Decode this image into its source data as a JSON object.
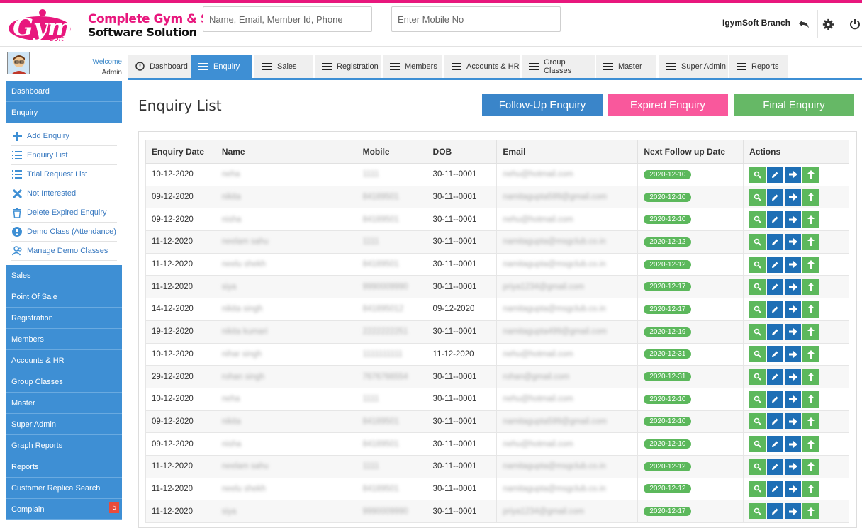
{
  "header": {
    "brand_line1": "Complete Gym & Spa",
    "brand_line2": "Software Solution",
    "search_placeholder": "Name, Email, Member Id, Phone",
    "mobile_placeholder": "Enter Mobile No",
    "branch": "IgymSoft Branch"
  },
  "user": {
    "welcome": "Welcome",
    "name": "Admin"
  },
  "sidebar": {
    "top_items": [
      "Dashboard",
      "Enquiry"
    ],
    "sub_items": [
      {
        "label": "Add Enquiry",
        "icon": "plus-icon"
      },
      {
        "label": "Enquiry List",
        "icon": "list-icon"
      },
      {
        "label": "Trial Request List",
        "icon": "list-icon"
      },
      {
        "label": "Not Interested",
        "icon": "close-icon"
      },
      {
        "label": "Delete Expired Enquiry",
        "icon": "trash-icon"
      },
      {
        "label": "Demo Class (Attendance)",
        "icon": "alert-icon"
      },
      {
        "label": "Manage Demo Classes",
        "icon": "users-icon"
      }
    ],
    "bottom_items": [
      "Sales",
      "Point Of Sale",
      "Registration",
      "Members",
      "Accounts & HR",
      "Group Classes",
      "Master",
      "Super Admin",
      "Graph Reports",
      "Reports",
      "Customer Replica Search",
      "Complain"
    ],
    "complain_badge": "5"
  },
  "tabs": [
    "Dashboard",
    "Enquiry",
    "Sales",
    "Registration",
    "Members",
    "Accounts & HR",
    "Group Classes",
    "Master",
    "Super Admin",
    "Reports"
  ],
  "page": {
    "title": "Enquiry List",
    "btn_followup": "Follow-Up Enquiry",
    "btn_expired": "Expired Enquiry",
    "btn_final": "Final Enquiry"
  },
  "table": {
    "columns": [
      "Enquiry Date",
      "Name",
      "Mobile",
      "DOB",
      "Email",
      "Next Follow up Date",
      "Actions"
    ],
    "rows": [
      [
        "10-12-2020",
        "neha",
        "1111",
        "30-11--0001",
        "nehu@hotmail.com",
        "2020-12-10"
      ],
      [
        "09-12-2020",
        "nikita",
        "84189501",
        "30-11--0001",
        "namitagupta599@gmail.com",
        "2020-12-10"
      ],
      [
        "09-12-2020",
        "nisha",
        "84189501",
        "30-11--0001",
        "nehu@hotmail.com",
        "2020-12-10"
      ],
      [
        "11-12-2020",
        "neelam sahu",
        "1111",
        "30-11--0001",
        "namitagupta@msgclub.co.in",
        "2020-12-12"
      ],
      [
        "11-12-2020",
        "neelu shekh",
        "84189501",
        "30-11--0001",
        "namitagupta@msgclub.co.in",
        "2020-12-12"
      ],
      [
        "11-12-2020",
        "siya",
        "9990009990",
        "30-11--0001",
        "priya1234@gmail.com",
        "2020-12-17"
      ],
      [
        "14-12-2020",
        "nikita singh",
        "841895012",
        "09-12-2020",
        "namitagupta@msgclub.co.in",
        "2020-12-17"
      ],
      [
        "19-12-2020",
        "nikita kumari",
        "2222222251",
        "30-11--0001",
        "namitagupta499@gmail.com",
        "2020-12-19"
      ],
      [
        "10-12-2020",
        "nihar singh",
        "1111111111",
        "11-12-2020",
        "nehu@hotmail.com",
        "2020-12-31"
      ],
      [
        "29-12-2020",
        "rohan singh",
        "7676766554",
        "30-11--0001",
        "rohan@gmail.com",
        "2020-12-31"
      ],
      [
        "10-12-2020",
        "neha",
        "1111",
        "30-11--0001",
        "nehu@hotmail.com",
        "2020-12-10"
      ],
      [
        "09-12-2020",
        "nikita",
        "84189501",
        "30-11--0001",
        "namitagupta599@gmail.com",
        "2020-12-10"
      ],
      [
        "09-12-2020",
        "nisha",
        "84189501",
        "30-11--0001",
        "nehu@hotmail.com",
        "2020-12-10"
      ],
      [
        "11-12-2020",
        "neelam sahu",
        "1111",
        "30-11--0001",
        "namitagupta@msgclub.co.in",
        "2020-12-12"
      ],
      [
        "11-12-2020",
        "neelu shekh",
        "84189501",
        "30-11--0001",
        "namitagupta@msgclub.co.in",
        "2020-12-12"
      ],
      [
        "11-12-2020",
        "siya",
        "9990009990",
        "30-11--0001",
        "priya1234@gmail.com",
        "2020-12-17"
      ]
    ],
    "action_icons": [
      "view-icon",
      "edit-icon",
      "forward-icon",
      "upload-icon"
    ]
  },
  "colors": {
    "accent": "#3e8fd4",
    "pink": "#f9589c",
    "green": "#5cb85c",
    "followup": "#3a85c9",
    "final": "#66b866"
  }
}
